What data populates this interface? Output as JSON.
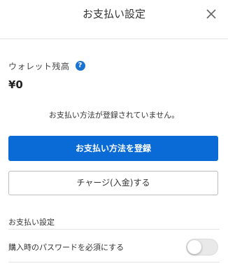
{
  "header": {
    "title": "お支払い設定",
    "close_icon": "close-icon"
  },
  "wallet": {
    "label": "ウォレット残高",
    "help_icon_glyph": "?",
    "balance": "¥0"
  },
  "payment": {
    "no_method_message": "お支払い方法が登録されていません。",
    "register_button": "お支払い方法を登録",
    "charge_button": "チャージ(入金)する"
  },
  "settings": {
    "section_title": "お支払い設定",
    "password_required_label": "購入時のパスワードを必須にする",
    "password_required_enabled": false
  },
  "colors": {
    "primary": "#0a6ad6",
    "help_icon": "#1a73d0"
  }
}
